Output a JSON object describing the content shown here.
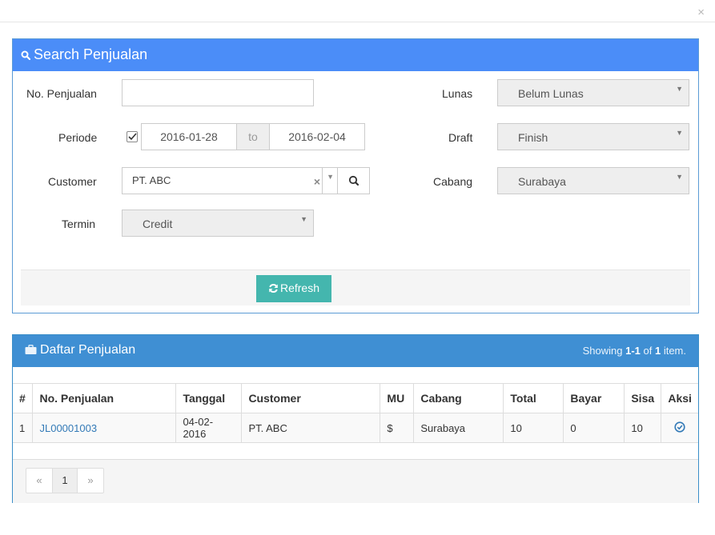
{
  "window": {
    "close_glyph": "×"
  },
  "search": {
    "title": "Search Penjualan",
    "no_penjualan_label": "No. Penjualan",
    "no_penjualan_value": "",
    "periode_label": "Periode",
    "date_from": "2016-01-28",
    "date_to_word": "to",
    "date_to": "2016-02-04",
    "customer_label": "Customer",
    "customer_value": "PT. ABC",
    "termin_label": "Termin",
    "termin_value": "Credit",
    "lunas_label": "Lunas",
    "lunas_value": "Belum Lunas",
    "draft_label": "Draft",
    "draft_value": "Finish",
    "cabang_label": "Cabang",
    "cabang_value": "Surabaya",
    "refresh_label": "Refresh"
  },
  "list": {
    "title": "Daftar Penjualan",
    "showing_prefix": "Showing ",
    "showing_range": "1-1",
    "showing_of": " of ",
    "showing_total": "1",
    "showing_suffix": " item.",
    "columns": [
      "#",
      "No. Penjualan",
      "Tanggal",
      "Customer",
      "MU",
      "Cabang",
      "Total",
      "Bayar",
      "Sisa",
      "Aksi"
    ],
    "rows": [
      {
        "num": "1",
        "no": "JL00001003",
        "tanggal": "04-02-2016",
        "customer": "PT. ABC",
        "mu": "$",
        "cabang": "Surabaya",
        "total": "10",
        "bayar": "0",
        "sisa": "10"
      }
    ],
    "pager": {
      "prev": "«",
      "current": "1",
      "next": "»"
    }
  },
  "colors": {
    "search_header": "#4b8df8",
    "list_header": "#3f8fd3",
    "refresh_button": "#44b6ae",
    "link": "#337ab7"
  }
}
